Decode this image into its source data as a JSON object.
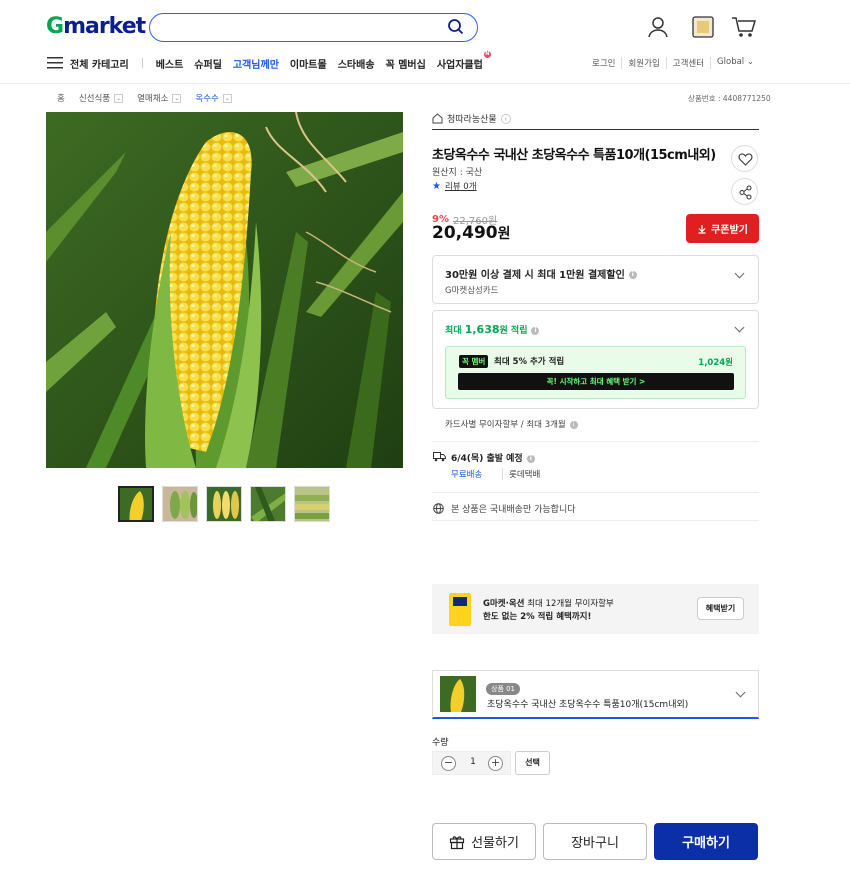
{
  "header": {
    "logo_g": "G",
    "logo_rest": "market",
    "search": {
      "value": "",
      "placeholder": ""
    },
    "icons": [
      "user-icon",
      "recent-icon",
      "cart-icon"
    ]
  },
  "nav": {
    "all_categories": "전체 카테고리",
    "items": [
      "베스트",
      "슈퍼딜",
      "고객님께만",
      "이마트몰",
      "스타배송",
      "꼭 멤버십",
      "사업자클럽"
    ],
    "highlight_index": 2,
    "dot_label": "N"
  },
  "util": [
    "로그인",
    "회원가입",
    "고객센터",
    "Global ⌄"
  ],
  "breadcrumb": [
    "홈",
    "신선식품",
    "열매채소",
    "옥수수"
  ],
  "product_no": "상품번호 : 4408771250",
  "seller": "청따라농산물",
  "title": "초당옥수수 국내산 초당옥수수 특품10개(15cm내외)",
  "origin": "원산지 : 국산",
  "review": "리뷰 0개",
  "price": {
    "discount_pct": "9%",
    "original": "22,760원",
    "sale_value": "20,490",
    "sale_unit": "원"
  },
  "coupon_button": "쿠폰받기",
  "card_offer": {
    "title": "30만원 이상 결제 시 최대 1만원 결제할인",
    "card": "G마켓삼성카드"
  },
  "points": {
    "prefix": "최대 ",
    "amount": "1,638",
    "suffix": "원 적립",
    "member_badge": "꼭 멤버",
    "member_text": "최대 5% 추가 적립",
    "member_amount": "1,024원",
    "member_cta": "꼭! 시작하고 최대 혜택 받기 >"
  },
  "installment": "카드사별 무이자할부 / 최대 3개월",
  "shipping": {
    "date": "6/4(목) 출발 예정",
    "free": "무료배송",
    "courier": "롯데택배"
  },
  "domestic": "본 상품은 국내배송만 가능합니다",
  "banner": {
    "brand": "G마켓·옥션",
    "line1_rest": " 최대 12개월 무이자할부",
    "line2": "한도 없는 2% 적립 혜택까지!",
    "button": "혜택받기"
  },
  "option": {
    "tag": "상품 01",
    "name": "초당옥수수 국내산 초당옥수수 특품10개(15cm내외)"
  },
  "quantity": {
    "label": "수량",
    "minus": "−",
    "value": "1",
    "plus": "+",
    "select": "선택"
  },
  "buttons": {
    "gift": "선물하기",
    "cart": "장바구니",
    "buy": "구매하기"
  },
  "colors": {
    "brand_green": "#00a650",
    "brand_blue": "#0a1f8f",
    "accent_blue": "#1f58f0",
    "coupon_red": "#e02020",
    "buy_blue": "#0a2fa6"
  }
}
